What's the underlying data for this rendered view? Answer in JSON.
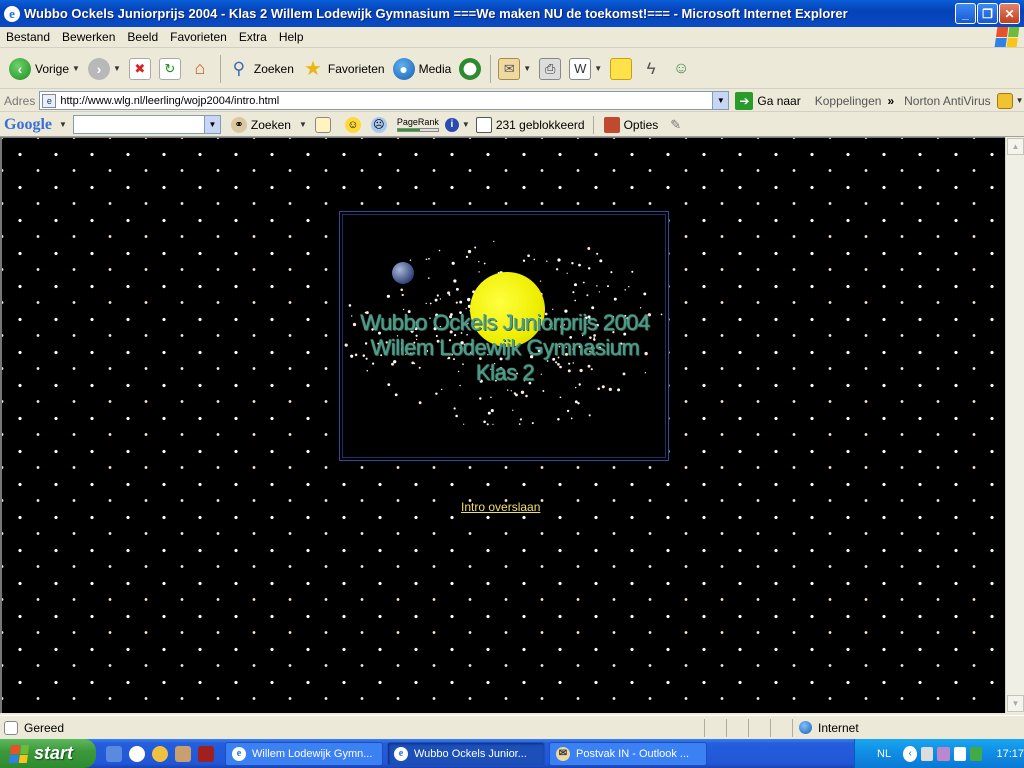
{
  "window": {
    "title": "Wubbo Ockels Juniorprijs 2004 - Klas 2 Willem Lodewijk Gymnasium ===We maken NU de toekomst!=== - Microsoft Internet Explorer",
    "min": "_",
    "max": "❐",
    "close": "✕"
  },
  "menu": [
    "Bestand",
    "Bewerken",
    "Beeld",
    "Favorieten",
    "Extra",
    "Help"
  ],
  "toolbar": {
    "back": "Vorige",
    "search": "Zoeken",
    "favorites": "Favorieten",
    "media": "Media"
  },
  "address": {
    "label": "Adres",
    "url": "http://www.wlg.nl/leerling/wojp2004/intro.html",
    "go": "Ga naar",
    "links": "Koppelingen",
    "links_chevron": "»",
    "norton": "Norton AntiVirus"
  },
  "google": {
    "logo": "Google",
    "search": "Zoeken",
    "pagerank": "PageRank",
    "blocked": "231 geblokkeerd",
    "options": "Opties"
  },
  "page": {
    "flash_lines": [
      "Wubbo Ockels Juniorprijs 2004",
      "Willem Lodewijk Gymnasium",
      "Klas 2"
    ],
    "skip": "Intro overslaan"
  },
  "status": {
    "text": "Gereed",
    "zone": "Internet"
  },
  "taskbar": {
    "start": "start",
    "tasks": [
      "Willem Lodewijk Gymn...",
      "Wubbo Ockels Junior...",
      "Postvak IN - Outlook ..."
    ],
    "lang": "NL",
    "time": "17:17"
  },
  "colors": {
    "titlebar": "#0542b8",
    "page_bg": "#000000",
    "sun": "#eeee00",
    "flash_text": "#4e9a86",
    "link": "#f0e060",
    "start": "#3c9a3c",
    "taskbar": "#245edb"
  },
  "icons": [
    "ie-icon",
    "back-arrow-icon",
    "forward-arrow-icon",
    "stop-icon",
    "refresh-icon",
    "home-icon",
    "search-icon",
    "favorites-star-icon",
    "media-icon",
    "history-icon",
    "mail-icon",
    "print-icon",
    "edit-icon",
    "discuss-icon",
    "messenger-icon",
    "go-arrow-icon",
    "windows-flag-icon"
  ]
}
